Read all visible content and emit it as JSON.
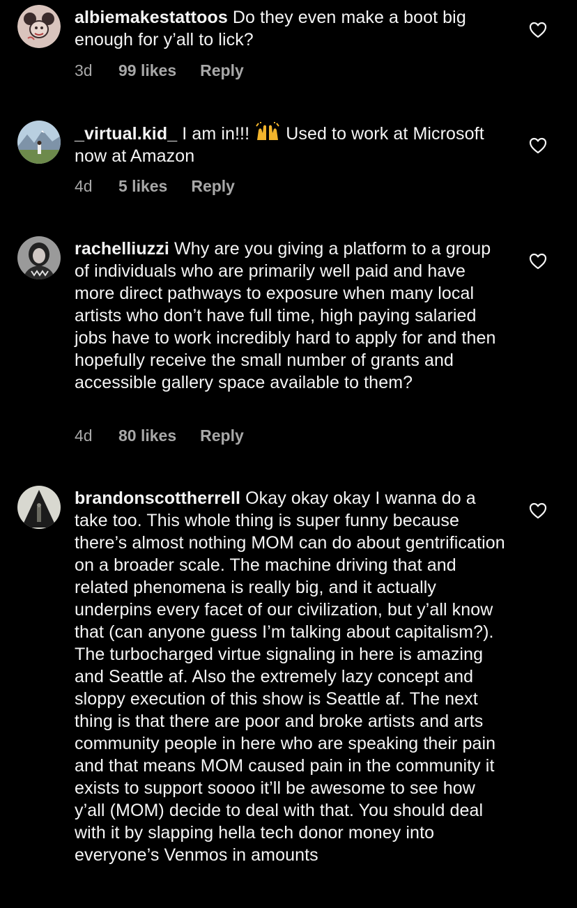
{
  "comments": [
    {
      "username": "albiemakestattoos",
      "text": " Do they even make a boot big enough for y’all to lick?",
      "time": "3d",
      "likes": "99 likes",
      "reply": "Reply",
      "avatar_icon": "cartoon-mouse-avatar"
    },
    {
      "username": "_virtual.kid_",
      "text_before": " I am in!!! ",
      "emoji": "raising-hands-emoji",
      "text_after": " Used to work at Microsoft now at Amazon",
      "time": "4d",
      "likes": "5 likes",
      "reply": "Reply",
      "avatar_icon": "mountain-landscape-avatar"
    },
    {
      "username": "rachelliuzzi",
      "text": " Why are you giving a platform to a group of individuals who are primarily well paid and have more direct pathways to exposure when many local artists who don’t have full time, high paying salaried jobs have to work incredibly hard to apply for and then hopefully receive the small number of grants and accessible gallery space available to them?",
      "time": "4d",
      "likes": "80 likes",
      "reply": "Reply",
      "avatar_icon": "portrait-avatar"
    },
    {
      "username": "brandonscottherrell",
      "text": " Okay okay okay I wanna do a take too. This whole thing is super funny because there’s almost nothing MOM can do about gentrification on a broader scale. The machine driving that and related phenomena is really big, and it actually underpins every facet of our civilization, but y’all know that (can anyone guess I’m talking about capitalism?). The turbocharged virtue signaling in here is amazing and Seattle af. Also the extremely lazy concept and sloppy execution of this show is Seattle af. The next thing is that there are poor and broke artists and arts community people in here who are speaking their pain and that means MOM caused pain in the community it exists to support soooo it’ll be awesome to see how y’all (MOM) decide to deal with that. You should deal with it by slapping hella tech donor money into everyone’s Venmos in amounts",
      "avatar_icon": "triangle-figure-avatar"
    }
  ],
  "colors": {
    "background": "#000000",
    "text": "#f5f5f5",
    "meta": "#a8a8a8"
  },
  "icons": {
    "like": "heart-outline-icon"
  }
}
